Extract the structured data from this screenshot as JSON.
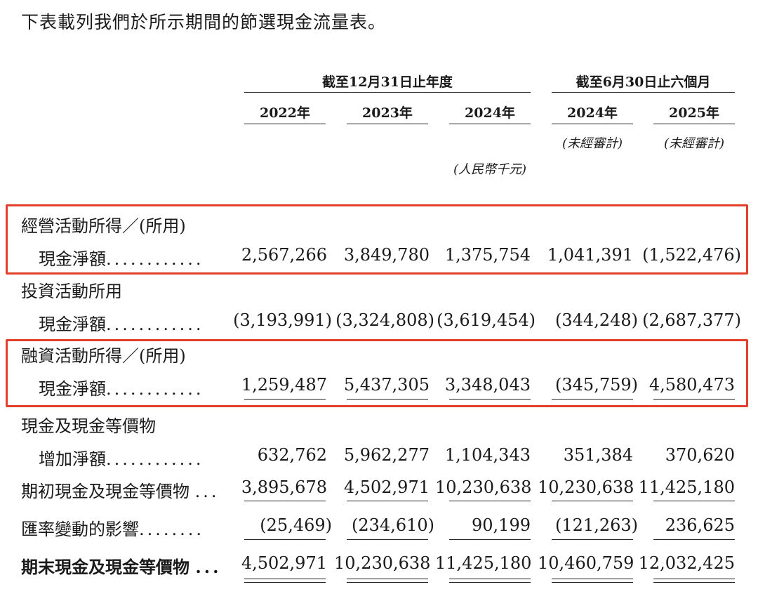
{
  "intro": "下表載列我們於所示期間的節選現金流量表。",
  "header": {
    "group_annual": "截至12月31日止年度",
    "group_half": "截至6月30日止六個月",
    "years": [
      "2022年",
      "2023年",
      "2024年",
      "2024年",
      "2025年"
    ],
    "unaudited": "(未經審計)",
    "unit": "(人民幣千元)"
  },
  "rows": [
    {
      "label1": "經營活動所得／(所用)",
      "label2": "現金淨額",
      "dots": "............",
      "values": [
        "2,567,266",
        "3,849,780",
        "1,375,754",
        "1,041,391",
        "(1,522,476)"
      ]
    },
    {
      "label1": "投資活動所用",
      "label2": "現金淨額",
      "dots": "............",
      "values": [
        "(3,193,991)",
        "(3,324,808)",
        "(3,619,454)",
        "(344,248)",
        "(2,687,377)"
      ]
    },
    {
      "label1": "融資活動所得／(所用)",
      "label2": "現金淨額",
      "dots": "............",
      "values": [
        "1,259,487",
        "5,437,305",
        "3,348,043",
        "(345,759)",
        "4,580,473"
      ]
    },
    {
      "label1": "現金及現金等價物",
      "label2": "增加淨額",
      "dots": "............",
      "values": [
        "632,762",
        "5,962,277",
        "1,104,343",
        "351,384",
        "370,620"
      ]
    },
    {
      "label": "期初現金及現金等價物",
      "dots": "...",
      "values": [
        "3,895,678",
        "4,502,971",
        "10,230,638",
        "10,230,638",
        "11,425,180"
      ]
    },
    {
      "label": "匯率變動的影響",
      "dots": "........",
      "values": [
        "(25,469)",
        "(234,610)",
        "90,199",
        "(121,263)",
        "236,625"
      ]
    },
    {
      "label": "期末現金及現金等價物",
      "dots": "...",
      "values": [
        "4,502,971",
        "10,230,638",
        "11,425,180",
        "10,460,759",
        "12,032,425"
      ]
    }
  ],
  "highlight_color": "#e2402b"
}
